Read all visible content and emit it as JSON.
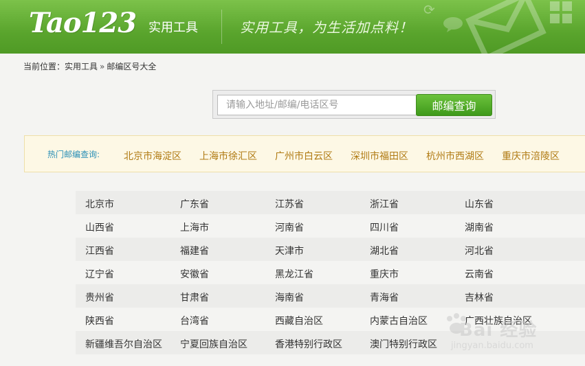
{
  "header": {
    "logo": "Tao123",
    "section_title": "实用工具",
    "slogan": "实用工具，为生活加点料！",
    "accent_color": "#5aa52d"
  },
  "breadcrumb": {
    "prefix": "当前位置：",
    "items": [
      "实用工具",
      "邮编区号大全"
    ],
    "separator": "»"
  },
  "search": {
    "placeholder": "请输入地址/邮编/电话区号",
    "value": "",
    "button_label": "邮编查询"
  },
  "hot": {
    "label": "热门邮编查询:",
    "links": [
      "北京市海淀区",
      "上海市徐汇区",
      "广州市白云区",
      "深圳市福田区",
      "杭州市西湖区",
      "重庆市涪陵区"
    ]
  },
  "regions": [
    [
      "北京市",
      "广东省",
      "江苏省",
      "浙江省",
      "山东省"
    ],
    [
      "山西省",
      "上海市",
      "河南省",
      "四川省",
      "湖南省"
    ],
    [
      "江西省",
      "福建省",
      "天津市",
      "湖北省",
      "河北省"
    ],
    [
      "辽宁省",
      "安徽省",
      "黑龙江省",
      "重庆市",
      "云南省"
    ],
    [
      "贵州省",
      "甘肃省",
      "海南省",
      "青海省",
      "吉林省"
    ],
    [
      "陕西省",
      "台湾省",
      "西藏自治区",
      "内蒙古自治区",
      "广西壮族自治区"
    ],
    [
      "新疆维吾尔自治区",
      "宁夏回族自治区",
      "香港特别行政区",
      "澳门特别行政区",
      ""
    ]
  ],
  "watermark": {
    "text": "Bai 经验",
    "url_text": "jingyan.baidu.com"
  }
}
